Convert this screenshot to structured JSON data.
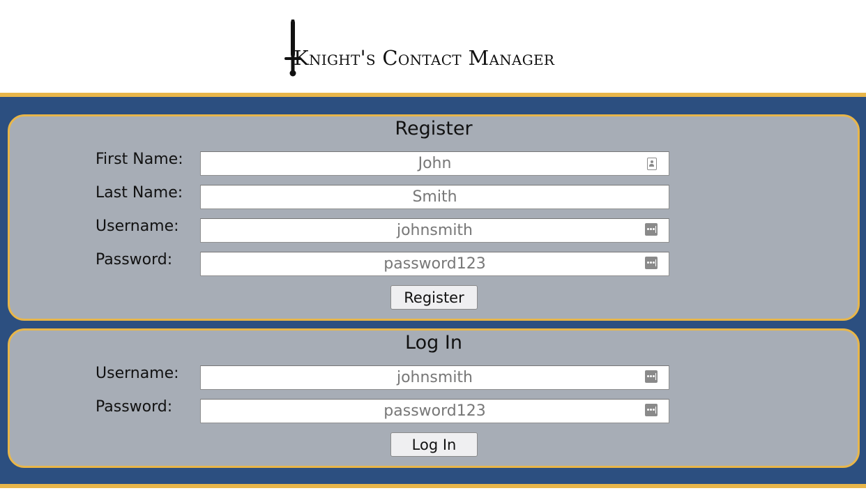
{
  "header": {
    "title": "Knight's Contact Manager",
    "logo_icon": "sword-icon"
  },
  "register": {
    "title": "Register",
    "fields": [
      {
        "label": "First Name:",
        "placeholder": "John",
        "icon": "contact-card-icon"
      },
      {
        "label": "Last Name:",
        "placeholder": "Smith",
        "icon": ""
      },
      {
        "label": "Username:",
        "placeholder": "johnsmith",
        "icon": "password-dots-icon"
      },
      {
        "label": "Password:",
        "placeholder": "password123",
        "icon": "password-dots-icon"
      }
    ],
    "button_label": "Register"
  },
  "login": {
    "title": "Log In",
    "fields": [
      {
        "label": "Username:",
        "placeholder": "johnsmith",
        "icon": "password-dots-icon"
      },
      {
        "label": "Password:",
        "placeholder": "password123",
        "icon": "password-dots-icon"
      }
    ],
    "button_label": "Log In"
  },
  "colors": {
    "accent_gold": "#e8b64a",
    "background_blue": "#2c4f80",
    "panel_gray": "#a7adb6"
  }
}
